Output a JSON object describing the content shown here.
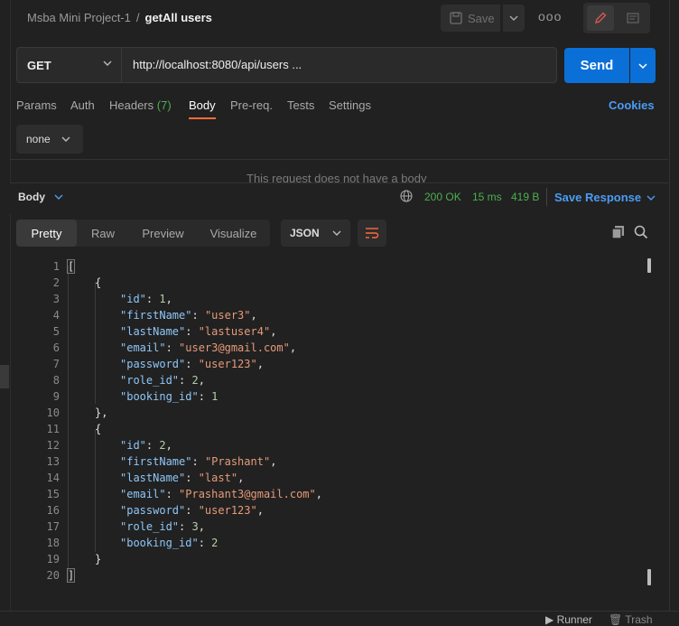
{
  "breadcrumb": {
    "collection": "Msba Mini Project-1",
    "separator": "/",
    "request": "getAll users"
  },
  "toolbar": {
    "save_label": "Save",
    "more_label": "ooo"
  },
  "request": {
    "method": "GET",
    "url": "http://localhost:8080/api/users ...",
    "send_label": "Send"
  },
  "tabs": {
    "params": "Params",
    "auth": "Auth",
    "headers": "Headers",
    "headers_count": "(7)",
    "body": "Body",
    "prereq": "Pre-req.",
    "tests": "Tests",
    "settings": "Settings",
    "cookies": "Cookies"
  },
  "body_type": "none",
  "no_body_message": "This request does not have a body",
  "response": {
    "body_label": "Body",
    "status": "200 OK",
    "time": "15 ms",
    "size": "419 B",
    "save_response": "Save Response"
  },
  "view": {
    "pretty": "Pretty",
    "raw": "Raw",
    "preview": "Preview",
    "visualize": "Visualize",
    "format": "JSON"
  },
  "code_lines": [
    "1",
    "2",
    "3",
    "4",
    "5",
    "6",
    "7",
    "8",
    "9",
    "10",
    "11",
    "12",
    "13",
    "14",
    "15",
    "16",
    "17",
    "18",
    "19",
    "20"
  ],
  "records": [
    {
      "id": "1",
      "firstName": "\"user3\"",
      "lastName": "\"lastuser4\"",
      "email": "\"user3@gmail.com\"",
      "password": "\"user123\"",
      "role_id": "2",
      "booking_id": "1"
    },
    {
      "id": "2",
      "firstName": "\"Prashant\"",
      "lastName": "\"last\"",
      "email": "\"Prashant3@gmail.com\"",
      "password": "\"user123\"",
      "role_id": "3",
      "booking_id": "2"
    }
  ],
  "json_keys": {
    "id": "\"id\"",
    "firstName": "\"firstName\"",
    "lastName": "\"lastName\"",
    "email": "\"email\"",
    "password": "\"password\"",
    "role_id": "\"role_id\"",
    "booking_id": "\"booking_id\""
  },
  "footer": {
    "runner": "Runner",
    "trash": "Trash"
  }
}
